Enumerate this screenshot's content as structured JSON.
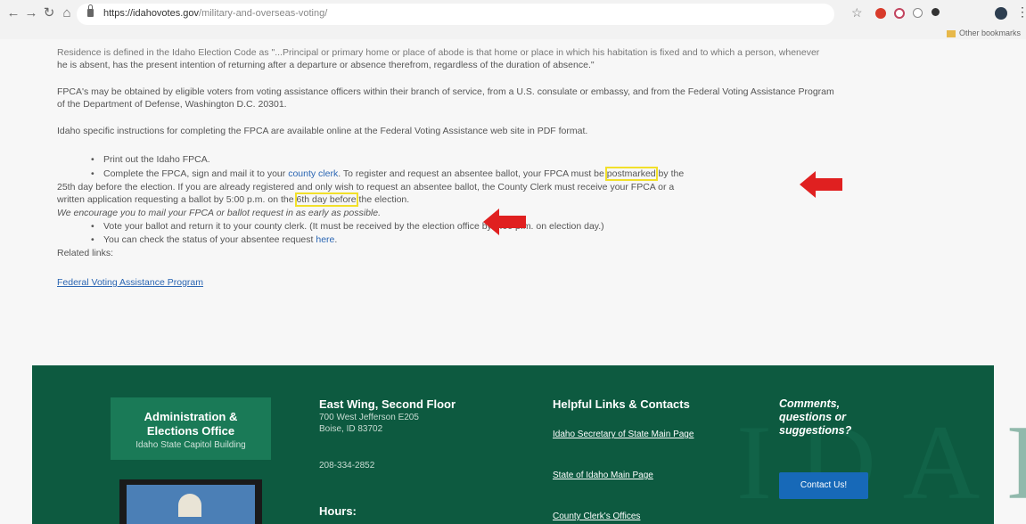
{
  "browser": {
    "url_host": "https://idahovotes.gov",
    "url_path": "/military-and-overseas-voting/",
    "bookmark_label": "Other bookmarks"
  },
  "content": {
    "para_residence_1": "Residence is defined in the Idaho Election Code as \"...Principal or primary home or place of abode is that home or place in which his habitation is fixed and to which a person, whenever",
    "para_residence_2": "he is absent, has the present intention of returning after a departure or absence therefrom, regardless of the duration of absence.\"",
    "para_fpca_1": "FPCA's may be obtained by eligible voters from voting assistance officers within their branch of service, from a U.S. consulate or embassy, and from the Federal Voting Assistance Program",
    "para_fpca_2": "of the Department of Defense, Washington D.C. 20301.",
    "para_instructions": "Idaho specific instructions for completing the FPCA are available online at the Federal Voting Assistance web site in PDF format.",
    "bullet_print": "Print out the Idaho FPCA.",
    "bullet_complete_a": "Complete the FPCA, sign and mail it to your ",
    "county_clerk_link": "county clerk",
    "bullet_complete_b": ". To register and request an absentee ballot, your FPCA must be ",
    "postmarked": "postmarked",
    "bullet_complete_c": " by the",
    "line_25th": "25th day before the election. If you are already registered and only wish to request an absentee ballot, the County Clerk must receive your FPCA or a",
    "line_written_a": "written application requesting a ballot by 5:00 p.m. on the ",
    "sixth_day": "6th day before",
    "line_written_b": " the election.",
    "encourage": "We encourage you to mail your FPCA or ballot request in as early as possible.",
    "bullet_vote": "Vote your ballot and return it to your county clerk. (It must be received by the election office by 8:00 p.m. on election day.)",
    "bullet_status_a": "You can check the status of your absentee request ",
    "here_link": "here",
    "bullet_status_b": ".",
    "related_links": "Related links:",
    "fvap_link": "Federal Voting Assistance Program"
  },
  "footer": {
    "admin_title_1": "Administration &",
    "admin_title_2": "Elections Office",
    "admin_sub": "Idaho State Capitol Building",
    "address_title": "East Wing, Second Floor",
    "address_1": "700 West Jefferson E205",
    "address_2": "Boise, ID 83702",
    "phone": "208-334-2852",
    "hours_title": "Hours:",
    "links_title": "Helpful Links & Contacts",
    "link_sos": "Idaho Secretary of State Main Page",
    "link_state": "State of Idaho Main Page",
    "link_clerks": "County Clerk's Offices",
    "comments_1": "Comments,",
    "comments_2": "questions or",
    "comments_3": "suggestions?",
    "contact_button": "Contact Us!",
    "watermark_text": "IDAHO"
  }
}
